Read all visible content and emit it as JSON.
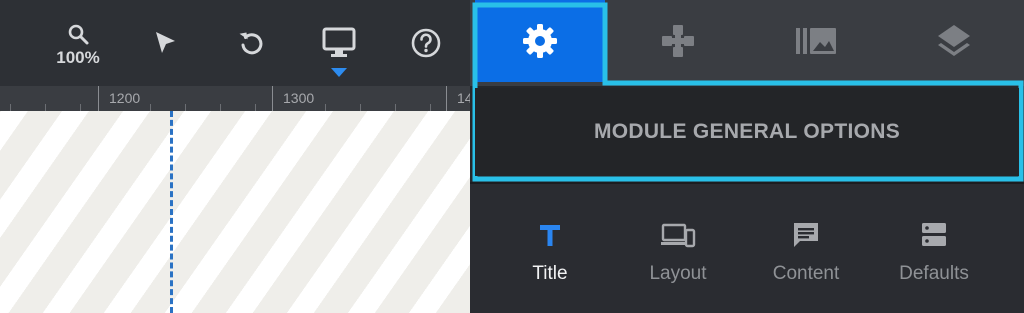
{
  "toolbar": {
    "zoom_label": "100%",
    "buttons": [
      {
        "name": "zoom",
        "icon": "search-icon"
      },
      {
        "name": "select",
        "icon": "cursor-arrow-icon"
      },
      {
        "name": "undo",
        "icon": "undo-icon"
      },
      {
        "name": "device-preview",
        "icon": "desktop-monitor-icon"
      },
      {
        "name": "help",
        "icon": "help-circle-icon"
      }
    ]
  },
  "ruler": {
    "labels": [
      "1200",
      "1300",
      "14"
    ]
  },
  "panel": {
    "tabs": [
      {
        "name": "general-options",
        "icon": "gear-icon",
        "active": true
      },
      {
        "name": "game",
        "icon": "gamepad-icon",
        "active": false
      },
      {
        "name": "media",
        "icon": "image-library-icon",
        "active": false
      },
      {
        "name": "layers",
        "icon": "layers-icon",
        "active": false
      }
    ],
    "section_title": "MODULE GENERAL OPTIONS",
    "subtabs": [
      {
        "label": "Title",
        "icon": "text-t-icon",
        "active": true
      },
      {
        "label": "Layout",
        "icon": "devices-icon",
        "active": false
      },
      {
        "label": "Content",
        "icon": "comment-icon",
        "active": false
      },
      {
        "label": "Defaults",
        "icon": "server-icon",
        "active": false
      }
    ]
  },
  "colors": {
    "accent": "#0b6ee6",
    "highlight": "#29c0e8",
    "caret": "#2d8cf0",
    "guide": "#2a72c4"
  }
}
